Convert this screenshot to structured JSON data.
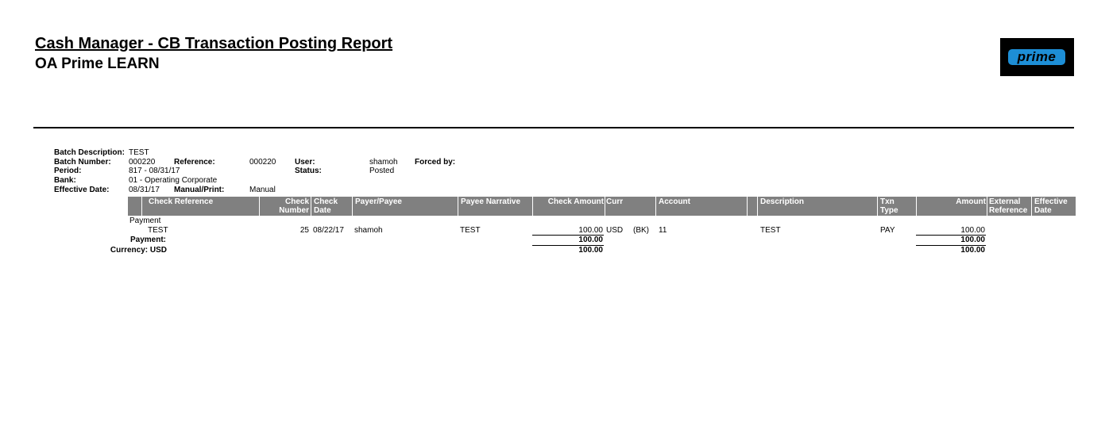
{
  "header": {
    "title": "Cash Manager - CB Transaction Posting Report",
    "subtitle": "OA Prime LEARN",
    "logo_text": "prime"
  },
  "batch": {
    "description_label": "Batch Description:",
    "description": "TEST",
    "number_label": "Batch Number:",
    "number": "000220",
    "reference_label": "Reference:",
    "reference": "000220",
    "user_label": "User:",
    "user": "shamoh",
    "forced_by_label": "Forced by:",
    "period_label": "Period:",
    "period": "817 - 08/31/17",
    "status_label": "Status:",
    "status": "Posted",
    "bank_label": "Bank:",
    "bank": "01 - Operating Corporate",
    "effective_date_label": "Effective Date:",
    "effective_date": "08/31/17",
    "manual_print_label": "Manual/Print:",
    "manual_print": "Manual"
  },
  "columns": {
    "check_reference": "Check Reference",
    "check_number_1": "Check",
    "check_number_2": "Number",
    "check_date_1": "Check",
    "check_date_2": "Date",
    "payer_payee": "Payer/Payee",
    "payee_narrative": "Payee Narrative",
    "check_amount": "Check Amount",
    "curr": "Curr",
    "account": "Account",
    "description": "Description",
    "txn_type_1": "Txn",
    "txn_type_2": "Type",
    "amount": "Amount",
    "external_reference_1": "External",
    "external_reference_2": "Reference",
    "effective_date_1": "Effective",
    "effective_date_2": "Date"
  },
  "group_label": "Payment",
  "row": {
    "check_reference": "TEST",
    "check_number": "25",
    "check_date": "08/22/17",
    "payer_payee": "shamoh",
    "payee_narrative": "TEST",
    "check_amount": "100.00",
    "curr": "USD",
    "account_prefix": "(BK)",
    "account": "11",
    "description": "TEST",
    "txn_type": "PAY",
    "amount": "100.00"
  },
  "totals": {
    "payment_label": "Payment:",
    "payment_check_amount": "100.00",
    "payment_amount": "100.00",
    "currency_label": "Currency: USD",
    "currency_check_amount": "100.00",
    "currency_amount": "100.00"
  }
}
